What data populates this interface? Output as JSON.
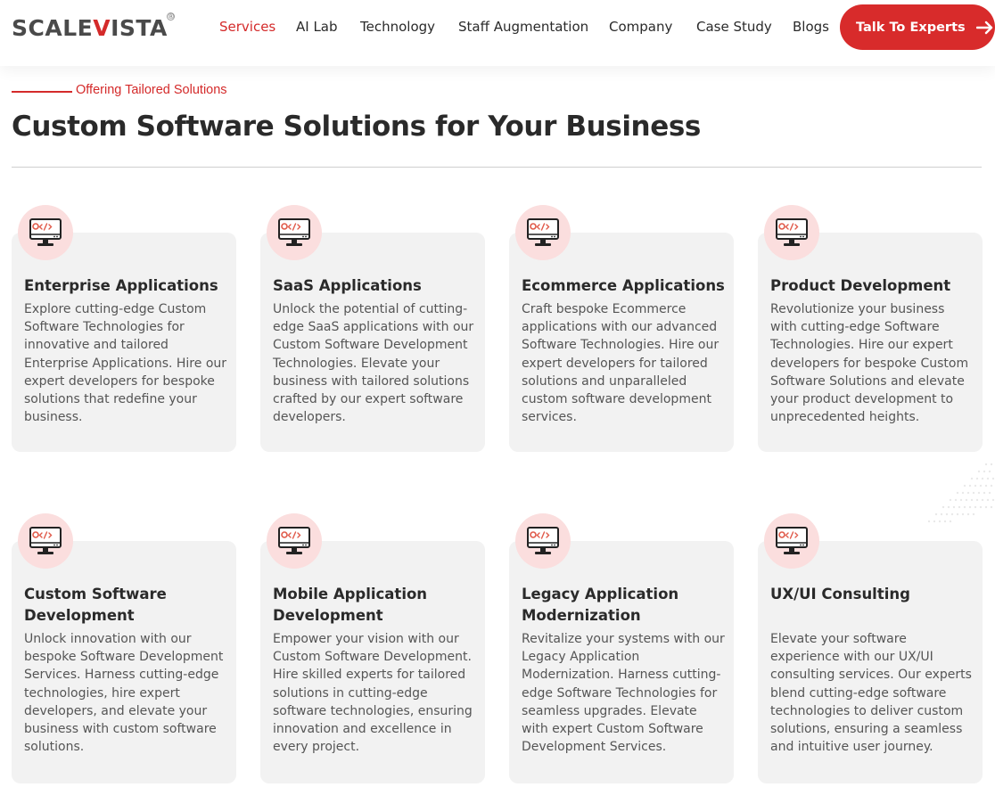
{
  "brand": {
    "logo_left": "SCALE",
    "logo_mark": "V",
    "logo_right": "ISTA",
    "trademark": "®"
  },
  "nav": {
    "items": [
      "Services",
      "AI Lab",
      "Technology",
      "Staff Augmentation",
      "Company",
      "Case Study",
      "Blogs"
    ],
    "active": "Services",
    "cta_label": "Talk To Experts"
  },
  "colors": {
    "accent": "#d82b2b",
    "card_bg": "#f2f2f2",
    "icon_bg": "#fbdede",
    "text": "#2a2a2a",
    "muted": "#555555"
  },
  "section": {
    "eyebrow": "Offering Tailored Solutions",
    "title": "Custom Software Solutions for Your Business"
  },
  "cards": [
    {
      "icon": "monitor-code-icon",
      "title": "Enterprise Applications",
      "description": "Explore cutting-edge Custom Software Technologies for innovative and tailored Enterprise Applications. Hire our expert developers for bespoke solutions that redefine your business."
    },
    {
      "icon": "monitor-code-icon",
      "title": "SaaS Applications",
      "description": "Unlock the potential of cutting-edge SaaS applications with our Custom Software Development Technologies. Elevate your business with tailored solutions crafted by our expert software developers."
    },
    {
      "icon": "monitor-code-icon",
      "title": "Ecommerce Applications",
      "description": "Craft bespoke Ecommerce applications with our advanced Software Technologies. Hire our expert developers for tailored solutions and unparalleled custom software development services."
    },
    {
      "icon": "monitor-code-icon",
      "title": "Product Development",
      "description": "Revolutionize your business with cutting-edge Software Technologies. Hire our expert developers for bespoke Custom Software Solutions and elevate your product development to unprecedented heights."
    },
    {
      "icon": "monitor-code-icon",
      "title": "Custom Software Development",
      "description": "Unlock innovation with our bespoke Software Development Services. Harness cutting-edge technologies, hire expert developers, and elevate your business with custom software solutions."
    },
    {
      "icon": "monitor-code-icon",
      "title": "Mobile Application Development",
      "description": "Empower your vision with our Custom Software Development. Hire skilled experts for tailored solutions in cutting-edge software technologies, ensuring innovation and excellence in every project."
    },
    {
      "icon": "monitor-code-icon",
      "title": "Legacy Application Modernization",
      "description": "Revitalize your systems with our Legacy Application Modernization. Harness cutting-edge Software Technologies for seamless upgrades. Elevate with expert Custom Software Development Services."
    },
    {
      "icon": "monitor-code-icon",
      "title": "UX/UI Consulting",
      "description": "Elevate your software experience with our UX/UI consulting services. Our experts blend cutting-edge software technologies to deliver custom solutions, ensuring a seamless and intuitive user journey."
    }
  ]
}
